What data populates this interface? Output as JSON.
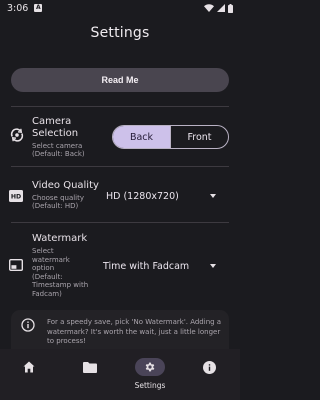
{
  "status_bar": {
    "time": "3:06",
    "notification_badge": "A",
    "icons": [
      "wifi-icon",
      "signal-icon",
      "battery-icon"
    ]
  },
  "page": {
    "title": "Settings"
  },
  "read_me": {
    "label": "Read Me"
  },
  "camera": {
    "title": "Camera Selection",
    "title_line1": "Camera",
    "title_line2": "Selection",
    "subtitle_line1": "Select camera",
    "subtitle_line2": "(Default: Back)",
    "options": [
      "Back",
      "Front"
    ],
    "selected": "Back"
  },
  "video_quality": {
    "title": "Video Quality",
    "subtitle_line1": "Choose quality",
    "subtitle_line2": "(Default: HD)",
    "value": "HD (1280x720)"
  },
  "watermark": {
    "title": "Watermark",
    "subtitle_lines": [
      "Select",
      "watermark",
      "option",
      "(Default:",
      "Timestamp with",
      "Fadcam)"
    ],
    "value": "Time with Fadcam"
  },
  "info": {
    "text": "For a speedy save, pick 'No Watermark'. Adding a watermark? It's worth the wait, just a little longer to process!"
  },
  "bottom_nav": {
    "items": [
      {
        "icon": "home-icon",
        "label": ""
      },
      {
        "icon": "folder-icon",
        "label": ""
      },
      {
        "icon": "gear-icon",
        "label": "Settings",
        "active": true
      },
      {
        "icon": "info-icon",
        "label": ""
      }
    ]
  },
  "colors": {
    "background": "#1b1b1f",
    "segment_selected": "#cdc1ea",
    "nav_active_pill": "#4a4458",
    "button": "#49454f"
  }
}
